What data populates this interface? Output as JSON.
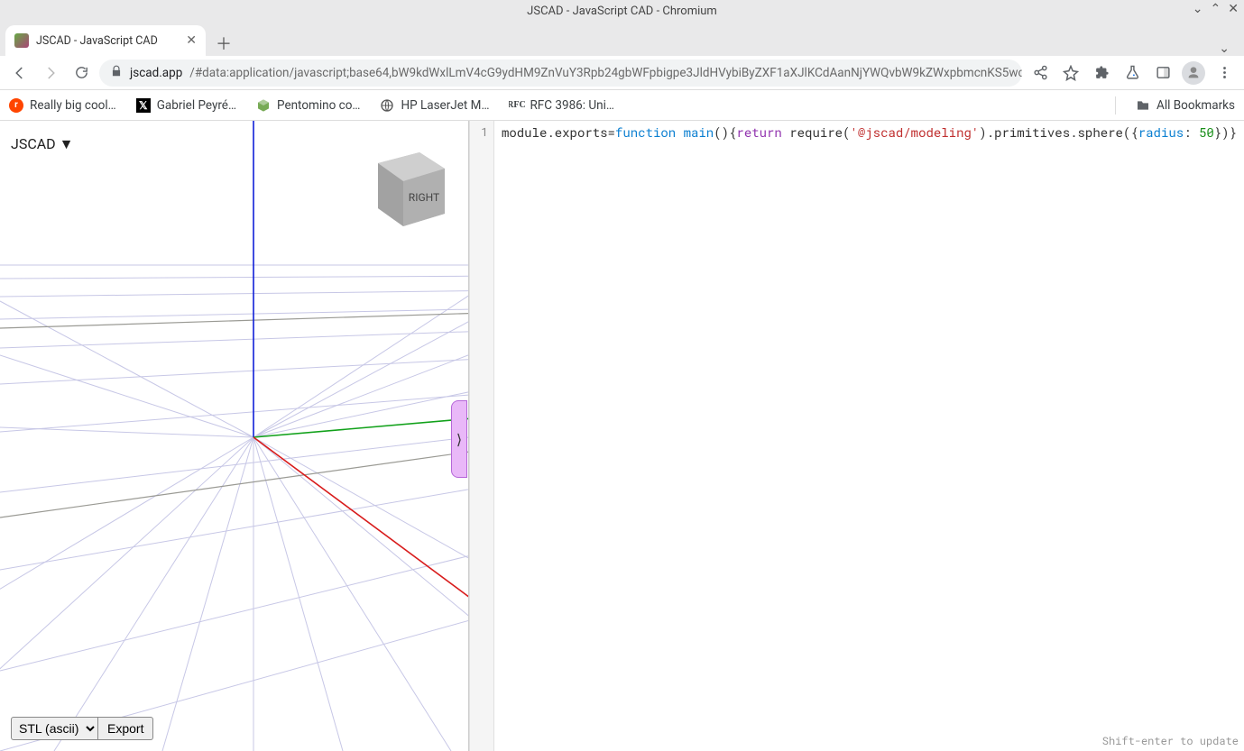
{
  "window": {
    "title": "JSCAD - JavaScript CAD - Chromium"
  },
  "tab": {
    "title": "JSCAD - JavaScript CAD"
  },
  "url": {
    "host": "jscad.app",
    "path": "/#data:application/javascript;base64,bW9kdWxlLmV4cG9ydHM9ZnVuY3Rpb24gbWFpbigpe3JldHVybiByZXF1aXJlKCdAanNjYWQvbW9kZWxpbmcnKS5wcmltaXRpdmVzLnNwaGVyZSh7cmFkaXVzOiA1MH0pfQ…"
  },
  "bookmarks": [
    {
      "label": "Really big cool…",
      "icon": "reddit"
    },
    {
      "label": "Gabriel Peyré…",
      "icon": "x"
    },
    {
      "label": "Pentomino co…",
      "icon": "cube"
    },
    {
      "label": "HP LaserJet M…",
      "icon": "globe"
    },
    {
      "label": "RFC 3986: Uni…",
      "icon": "rfc"
    }
  ],
  "allBookmarks": "All Bookmarks",
  "app": {
    "menuLabel": "JSCAD ▼",
    "cubeFace": "RIGHT",
    "exportFormat": "STL (ascii)",
    "exportBtn": "Export",
    "handleGlyph": "⟩"
  },
  "editor": {
    "lineNum": "1",
    "code": {
      "p1": "module.exports=",
      "kw_function": "function",
      "fn_main": " main",
      "p2": "(){",
      "kw_return": "return",
      "p3": " require(",
      "str": "'@jscad/modeling'",
      "p4": ").primitives.sphere({",
      "prop": "radius",
      "p5": ": ",
      "num": "50",
      "p6": "})}"
    },
    "hint": "Shift-enter to update"
  }
}
